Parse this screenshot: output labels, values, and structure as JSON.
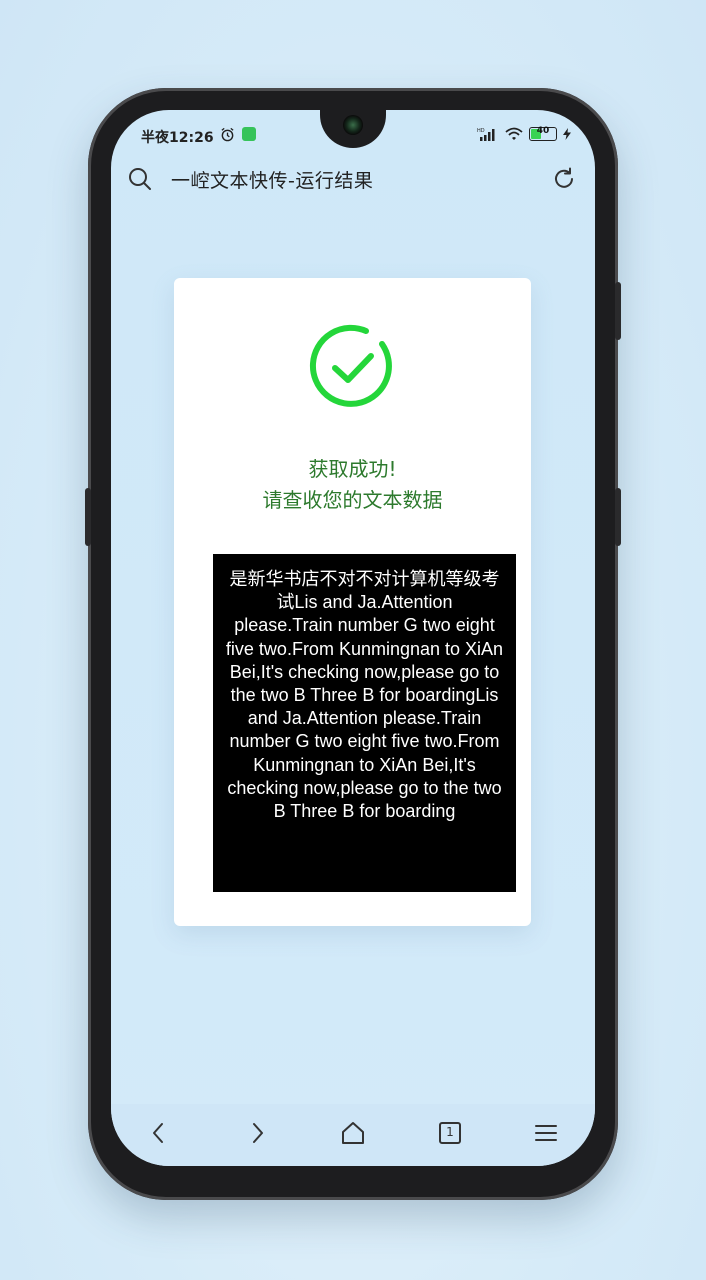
{
  "status_bar": {
    "time": "半夜12:26",
    "battery_level": "40",
    "icons": [
      "alarm-icon",
      "message-icon",
      "hd-signal-icon",
      "wifi-icon",
      "battery-icon",
      "charging-icon"
    ]
  },
  "toolbar": {
    "title": "一崆文本快传-运行结果",
    "search_icon": "search-icon",
    "refresh_icon": "refresh-icon"
  },
  "result_card": {
    "icon": "check-circle-icon",
    "success_color": "#24d63a",
    "title": "获取成功!",
    "subtitle": "请查收您的文本数据",
    "text_content": "是新华书店不对不对计算机等级考试Lis and Ja.Attention please.Train number G two eight five two.From Kunmingnan to XiAn Bei,It's checking now,please go to the two B Three B for boardingLis and Ja.Attention please.Train number G two eight five two.From Kunmingnan to XiAn Bei,It's checking now,please go to the two B Three B for boarding"
  },
  "bottom_nav": {
    "items": [
      "back-icon",
      "forward-icon",
      "home-icon",
      "tabs-icon",
      "menu-icon"
    ],
    "tab_count": "1"
  }
}
